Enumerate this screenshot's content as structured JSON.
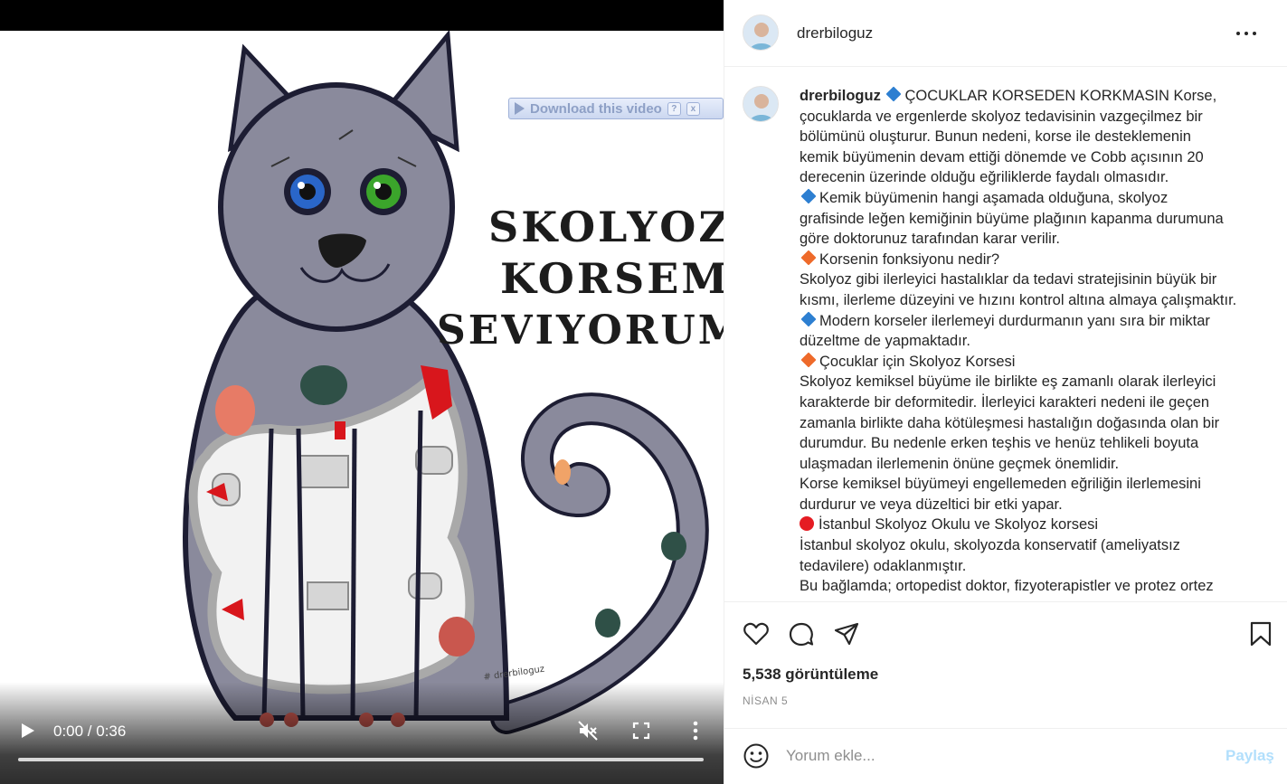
{
  "video": {
    "download_bar": {
      "label": "Download this video",
      "help_label": "?",
      "close_label": "x"
    },
    "artwork": {
      "title_lines": [
        "SKOLYOZ",
        "KORSEMI",
        "SEVIYORUM"
      ],
      "signature": "# drerbiloguz"
    },
    "controls": {
      "time": "0:00 / 0:36",
      "progress_fraction": 0
    }
  },
  "post": {
    "header": {
      "username": "drerbiloguz",
      "more_icon": "more-horizontal-icon"
    },
    "caption": {
      "username": "drerbiloguz",
      "lines": [
        {
          "marker": "blue",
          "text": "ÇOCUKLAR KORSEDEN KORKMASIN Korse,",
          "first": true
        },
        {
          "marker": "",
          "text": "çocuklarda ve ergenlerde skolyoz tedavisinin vazgeçilmez bir"
        },
        {
          "marker": "",
          "text": "bölümünü oluşturur. Bunun nedeni, korse ile desteklemenin"
        },
        {
          "marker": "",
          "text": "kemik büyümenin devam ettiği dönemde ve Cobb açısının 20"
        },
        {
          "marker": "",
          "text": "derecenin üzerinde olduğu eğriliklerde faydalı olmasıdır."
        },
        {
          "marker": "blue",
          "text": "Kemik büyümenin hangi aşamada olduğuna, skolyoz"
        },
        {
          "marker": "",
          "text": "grafisinde leğen kemiğinin büyüme plağının kapanma durumuna"
        },
        {
          "marker": "",
          "text": "göre doktorunuz tarafından karar verilir."
        },
        {
          "marker": "orange",
          "text": "Korsenin fonksiyonu nedir?"
        },
        {
          "marker": "",
          "text": "Skolyoz gibi ilerleyici hastalıklar da tedavi stratejisinin büyük bir"
        },
        {
          "marker": "",
          "text": "kısmı, ilerleme düzeyini ve hızını kontrol altına almaya çalışmaktır."
        },
        {
          "marker": "blue",
          "text": "Modern korseler ilerlemeyi durdurmanın yanı sıra bir miktar"
        },
        {
          "marker": "",
          "text": "düzeltme de yapmaktadır."
        },
        {
          "marker": "orange",
          "text": "Çocuklar için Skolyoz Korsesi"
        },
        {
          "marker": "",
          "text": "Skolyoz kemiksel büyüme ile birlikte eş zamanlı olarak ilerleyici"
        },
        {
          "marker": "",
          "text": "karakterde bir deformitedir. İlerleyici karakteri nedeni ile geçen"
        },
        {
          "marker": "",
          "text": "zamanla birlikte daha kötüleşmesi hastalığın doğasında olan bir"
        },
        {
          "marker": "",
          "text": "durumdur. Bu nedenle erken teşhis ve henüz tehlikeli boyuta"
        },
        {
          "marker": "",
          "text": "ulaşmadan ilerlemenin önüne geçmek önemlidir."
        },
        {
          "marker": "",
          "text": "Korse kemiksel büyümeyi engellemeden eğriliğin ilerlemesini"
        },
        {
          "marker": "",
          "text": "durdurur ve veya düzeltici bir etki yapar."
        },
        {
          "marker": "red",
          "text": "İstanbul Skolyoz Okulu ve Skolyoz korsesi"
        },
        {
          "marker": "",
          "text": "İstanbul skolyoz okulu, skolyozda konservatif (ameliyatsız"
        },
        {
          "marker": "",
          "text": "tedavilere) odaklanmıştır."
        },
        {
          "marker": "",
          "text": "Bu bağlamda; ortopedist doktor, fizyoterapistler ve protez ortez"
        }
      ]
    },
    "actions": {
      "like_icon": "heart-icon",
      "comment_icon": "comment-icon",
      "share_icon": "share-icon",
      "save_icon": "bookmark-icon"
    },
    "views": "5,538 görüntüleme",
    "date": "NİSAN 5",
    "comment": {
      "placeholder": "Yorum ekle...",
      "post_label": "Paylaş"
    },
    "colors": {
      "marker_blue": "#2d7fd1",
      "marker_orange": "#ee6a2a",
      "marker_red": "#e51c23",
      "post_button": "#b2dffc"
    }
  }
}
